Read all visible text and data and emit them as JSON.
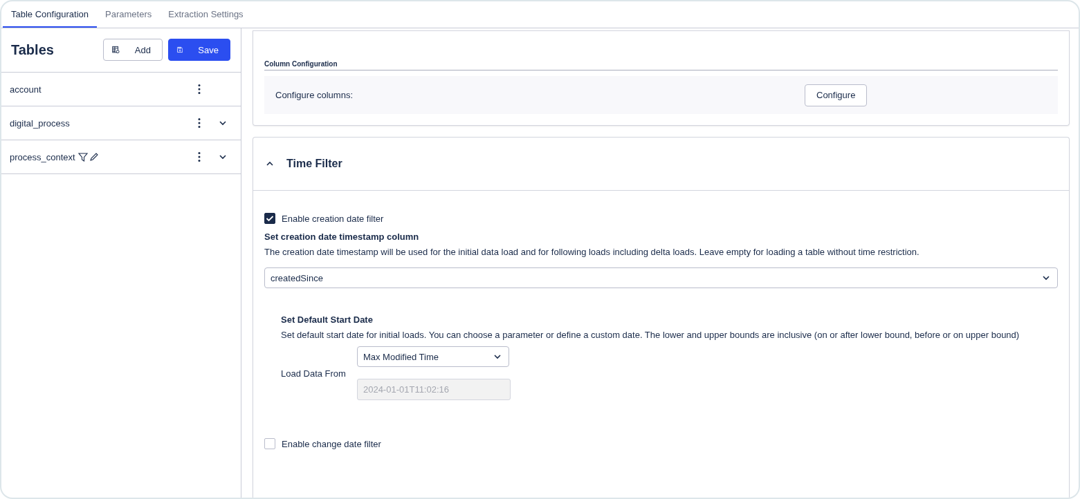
{
  "tabs": [
    {
      "label": "Table Configuration",
      "selected": true
    },
    {
      "label": "Parameters",
      "selected": false
    },
    {
      "label": "Extraction Settings",
      "selected": false
    }
  ],
  "sidebar": {
    "title": "Tables",
    "add_button": "Add",
    "save_button": "Save",
    "tables": [
      {
        "name": "account",
        "filtered": false,
        "expandable": false
      },
      {
        "name": "digital_process",
        "filtered": false,
        "expandable": true
      },
      {
        "name": "process_context",
        "filtered": true,
        "expandable": true
      }
    ]
  },
  "column_configuration": {
    "heading": "Column Configuration",
    "label": "Configure columns:",
    "button": "Configure"
  },
  "time_filter": {
    "title": "Time Filter",
    "expanded": true,
    "creation_filter": {
      "label": "Enable creation date filter",
      "checked": true
    },
    "timestamp_heading": "Set creation date timestamp column",
    "timestamp_description": "The creation date timestamp will be used for the initial data load and for following loads including delta loads. Leave empty for loading a table without time restriction.",
    "timestamp_value": "createdSince",
    "start_date_heading": "Set Default Start Date",
    "start_date_description": "Set default start date for initial loads. You can choose a parameter or define a custom date. The lower and upper bounds are inclusive (on or after lower bound, before or on upper bound)",
    "load_from_label": "Load Data From",
    "load_from_value": "Max Modified Time",
    "date_value": "2024-01-01T11:02:16",
    "change_filter": {
      "label": "Enable change date filter",
      "checked": false
    }
  }
}
